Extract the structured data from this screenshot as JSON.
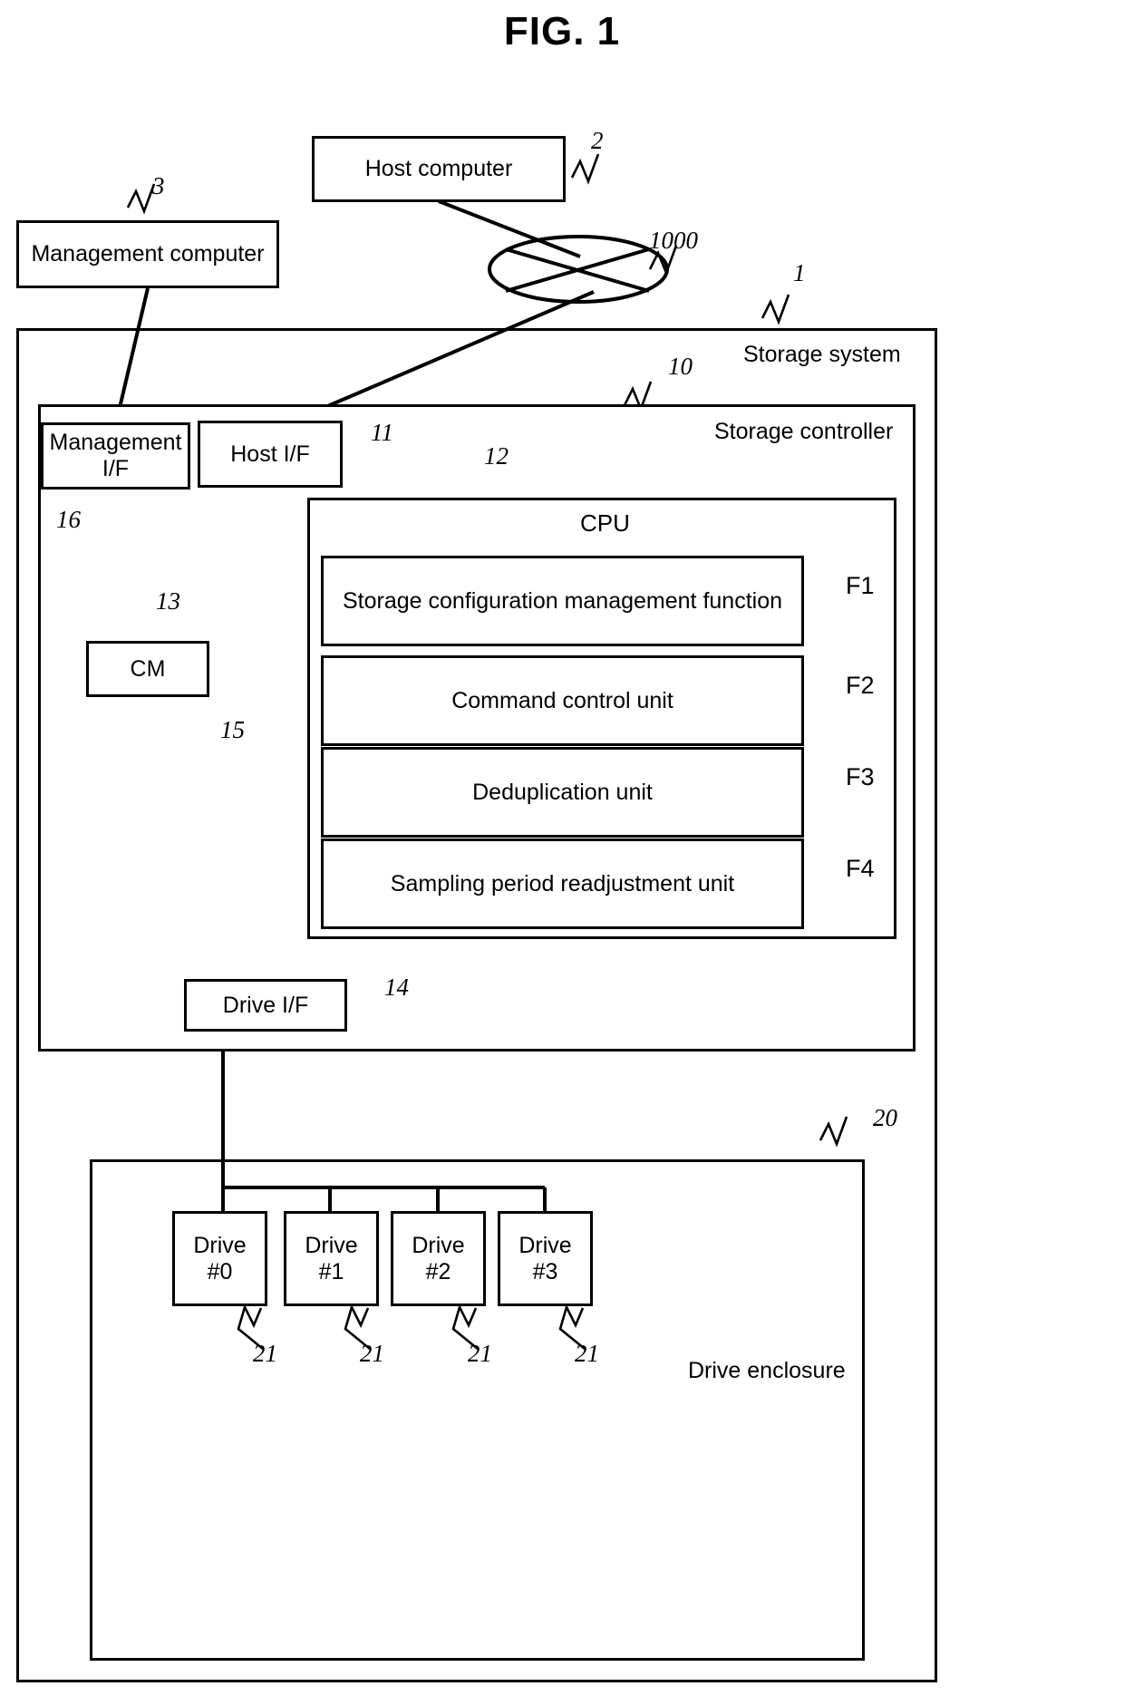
{
  "figure": {
    "title": "FIG. 1"
  },
  "nodes": {
    "host_computer": {
      "label": "Host computer",
      "ref": "2"
    },
    "management_computer": {
      "label": "Management computer",
      "ref": "3"
    },
    "network": {
      "ref": "1000"
    },
    "storage_system": {
      "label": "Storage system",
      "ref": "1"
    },
    "storage_controller": {
      "label": "Storage controller",
      "ref": "10"
    },
    "management_if": {
      "label": "Management\nI/F",
      "line1": "Management",
      "line2": "I/F",
      "ref": "16"
    },
    "host_if": {
      "label": "Host I/F",
      "ref": "11"
    },
    "cpu": {
      "label": "CPU",
      "ref": "12"
    },
    "cm": {
      "label": "CM",
      "ref": "13"
    },
    "internal_bus": {
      "ref": "15"
    },
    "drive_if": {
      "label": "Drive I/F",
      "ref": "14"
    },
    "drive_enclosure": {
      "label": "Drive enclosure",
      "ref": "20"
    }
  },
  "cpu_functions": [
    {
      "label": "Storage configuration management function",
      "ref": "F1"
    },
    {
      "label": "Command control unit",
      "ref": "F2"
    },
    {
      "label": "Deduplication unit",
      "ref": "F3"
    },
    {
      "label": "Sampling period readjustment unit",
      "ref": "F4"
    }
  ],
  "drives": [
    {
      "line1": "Drive",
      "line2": "#0",
      "ref": "21"
    },
    {
      "line1": "Drive",
      "line2": "#1",
      "ref": "21"
    },
    {
      "line1": "Drive",
      "line2": "#2",
      "ref": "21"
    },
    {
      "line1": "Drive",
      "line2": "#3",
      "ref": "21"
    }
  ],
  "colors": {
    "stroke": "#000000",
    "background": "#ffffff"
  }
}
